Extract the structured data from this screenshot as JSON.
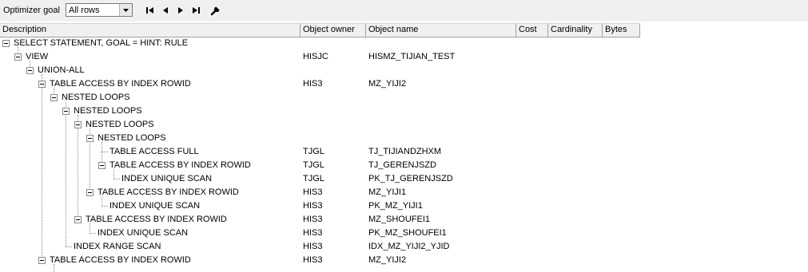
{
  "toolbar": {
    "optimizer_label": "Optimizer goal",
    "optimizer_value": "All rows",
    "buttons": [
      "first-icon",
      "previous-icon",
      "next-icon",
      "last-icon",
      "wrench-icon"
    ]
  },
  "columns": [
    "Description",
    "Object owner",
    "Object name",
    "Cost",
    "Cardinality",
    "Bytes"
  ],
  "rows": [
    {
      "desc": "SELECT STATEMENT, GOAL = HINT: RULE",
      "owner": "",
      "name": "",
      "depth": 0,
      "expandable": true
    },
    {
      "desc": "VIEW",
      "owner": "HISJC",
      "name": "HISMZ_TIJIAN_TEST",
      "depth": 1,
      "expandable": true
    },
    {
      "desc": "UNION-ALL",
      "owner": "",
      "name": "",
      "depth": 2,
      "expandable": true
    },
    {
      "desc": "TABLE ACCESS BY INDEX ROWID",
      "owner": "HIS3",
      "name": "MZ_YIJI2",
      "depth": 3,
      "expandable": true
    },
    {
      "desc": "NESTED LOOPS",
      "owner": "",
      "name": "",
      "depth": 4,
      "expandable": true
    },
    {
      "desc": "NESTED LOOPS",
      "owner": "",
      "name": "",
      "depth": 5,
      "expandable": true
    },
    {
      "desc": "NESTED LOOPS",
      "owner": "",
      "name": "",
      "depth": 6,
      "expandable": true
    },
    {
      "desc": "NESTED LOOPS",
      "owner": "",
      "name": "",
      "depth": 7,
      "expandable": true
    },
    {
      "desc": "TABLE ACCESS FULL",
      "owner": "TJGL",
      "name": "TJ_TIJIANDZHXM",
      "depth": 8,
      "expandable": false
    },
    {
      "desc": "TABLE ACCESS BY INDEX ROWID",
      "owner": "TJGL",
      "name": "TJ_GERENJSZD",
      "depth": 8,
      "expandable": true
    },
    {
      "desc": "INDEX UNIQUE SCAN",
      "owner": "TJGL",
      "name": "PK_TJ_GERENJSZD",
      "depth": 9,
      "expandable": false
    },
    {
      "desc": "TABLE ACCESS BY INDEX ROWID",
      "owner": "HIS3",
      "name": "MZ_YIJI1",
      "depth": 7,
      "expandable": true
    },
    {
      "desc": "INDEX UNIQUE SCAN",
      "owner": "HIS3",
      "name": "PK_MZ_YIJI1",
      "depth": 8,
      "expandable": false
    },
    {
      "desc": "TABLE ACCESS BY INDEX ROWID",
      "owner": "HIS3",
      "name": "MZ_SHOUFEI1",
      "depth": 6,
      "expandable": true
    },
    {
      "desc": "INDEX UNIQUE SCAN",
      "owner": "HIS3",
      "name": "PK_MZ_SHOUFEI1",
      "depth": 7,
      "expandable": false
    },
    {
      "desc": "INDEX RANGE SCAN",
      "owner": "HIS3",
      "name": "IDX_MZ_YIJI2_YJID",
      "depth": 5,
      "expandable": false
    },
    {
      "desc": "TABLE ACCESS BY INDEX ROWID",
      "owner": "HIS3",
      "name": "MZ_YIJI2",
      "depth": 3,
      "expandable": true
    }
  ]
}
